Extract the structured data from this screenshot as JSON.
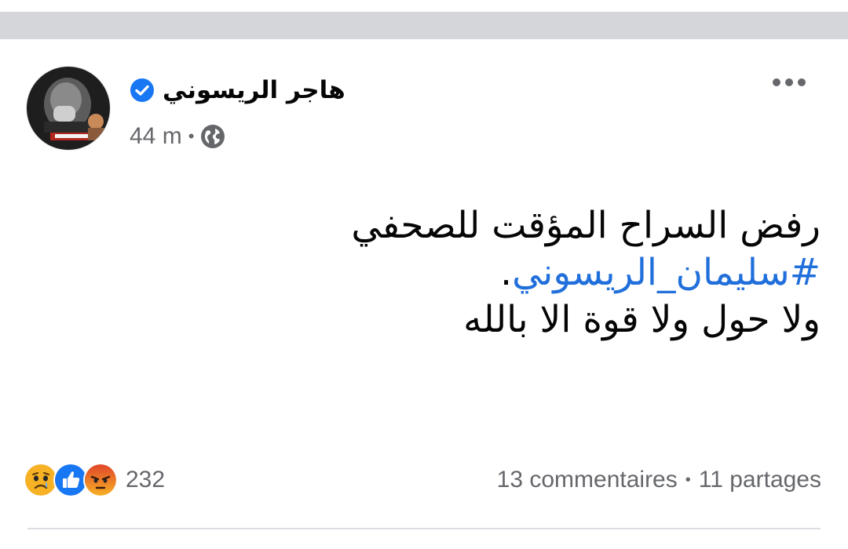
{
  "post": {
    "author_name": "هاجر الريسوني",
    "timestamp": "44 m",
    "meta_separator": "•",
    "audience_icon": "globe-icon",
    "verified_icon": "verified-badge-icon",
    "more_icon": "more-options-icon",
    "text_line_1": "رفض السراح المؤقت للصحفي",
    "hashtag": "#سليمان_الريسوني",
    "hashtag_suffix": ".",
    "text_line_3": "ولا حول ولا قوة الا بالله"
  },
  "reactions": {
    "icons": [
      "sad-reaction-icon",
      "like-reaction-icon",
      "angry-reaction-icon"
    ],
    "count": "232"
  },
  "engagement": {
    "comments": "13 commentaires",
    "separator": "•",
    "shares": "11 partages"
  },
  "colors": {
    "top_band": "#d4d6da",
    "text_primary": "#050505",
    "text_secondary": "#65676b",
    "hashtag": "#216fdb",
    "verified": "#1877f2",
    "like": "#1877f2",
    "angry": "#e9710f",
    "sad": "#f7b125"
  }
}
